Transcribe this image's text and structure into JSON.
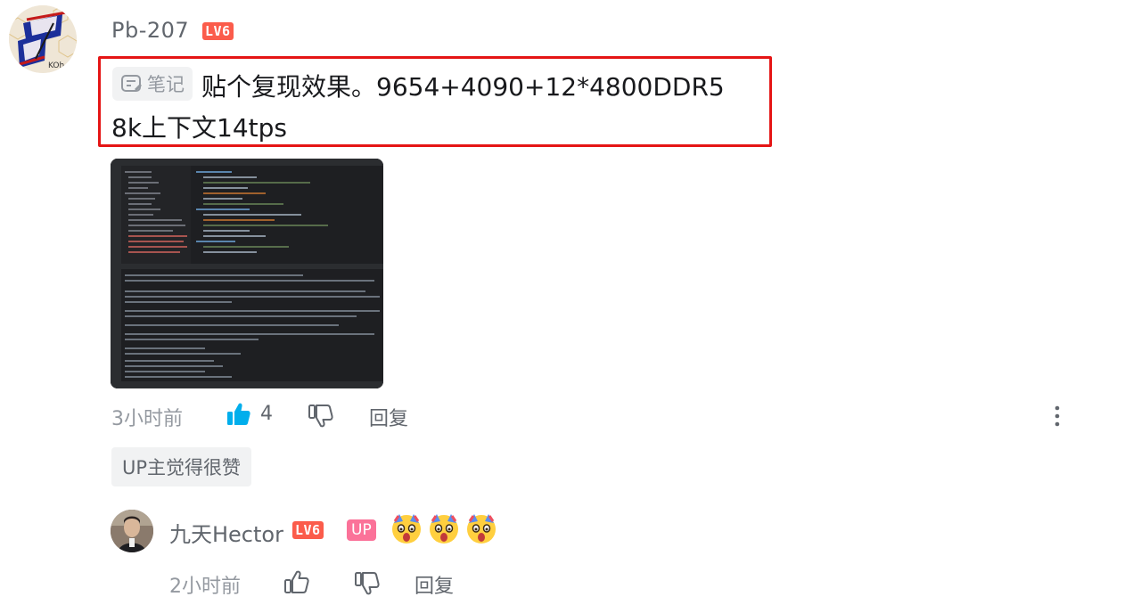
{
  "comment": {
    "username": "Pb-207",
    "level_badge": "LV6",
    "note_tag": "笔记",
    "text_line1": "贴个复现效果。9654+4090+12*4800DDR5",
    "text_line2": "8k上下文14tps",
    "time": "3小时前",
    "like_count": "4",
    "reply_label": "回复",
    "up_liked_label": "UP主觉得很赞",
    "highlight_color": "#e51515",
    "like_color": "#00aeec"
  },
  "reply": {
    "username": "九天Hector",
    "level_badge": "LV6",
    "up_badge": "UP",
    "time": "2小时前",
    "reply_label": "回复",
    "emoji_count": 3
  }
}
